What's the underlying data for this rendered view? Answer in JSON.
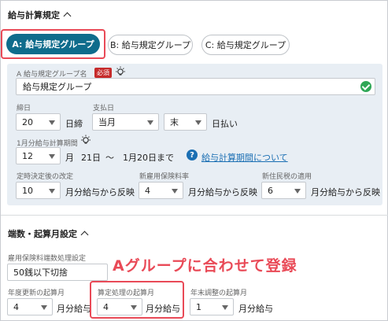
{
  "section1": {
    "title": "給与計算規定"
  },
  "tabs": [
    {
      "label": "A: 給与規定グループ"
    },
    {
      "label": "B: 給与規定グループ"
    },
    {
      "label": "C: 給与規定グループ"
    }
  ],
  "group_name": {
    "label": "A 給与規定グループ名",
    "required_badge": "必須",
    "value": "給与規定グループ"
  },
  "closing_day": {
    "label": "締日",
    "value": "20",
    "suffix": "日締"
  },
  "pay_day": {
    "label": "支払日",
    "month_value": "当月",
    "day_value": "末",
    "suffix": "日払い"
  },
  "period": {
    "label": "1月分給与計算期間",
    "month_value": "12",
    "month_suffix": "月",
    "start": "21日",
    "tilde": "〜",
    "end": "1月20日まで",
    "help_link": "給与計算期間について"
  },
  "regular_revision": {
    "label": "定時決定後の改定",
    "value": "10",
    "suffix": "月分給与から反映"
  },
  "health_insurance": {
    "label": "新雇用保険料率",
    "value": "4",
    "suffix": "月分給与から反映"
  },
  "resident_tax": {
    "label": "新住民税の適用",
    "value": "6",
    "suffix": "月分給与から反映"
  },
  "section2": {
    "title": "端数・起算月設定"
  },
  "rounding": {
    "label": "雇用保険料端数処理設定",
    "value": "50銭以下切捨"
  },
  "annual_update": {
    "label": "年度更新の起算月",
    "value": "4",
    "suffix": "月分給与"
  },
  "calc_start": {
    "label": "算定処理の起算月",
    "value": "4",
    "suffix": "月分給与"
  },
  "year_end": {
    "label": "年末調整の起算月",
    "value": "1",
    "suffix": "月分給与"
  },
  "annotation": {
    "text": "Aグループに合わせて登録"
  },
  "colors": {
    "accent": "#0f6c8c",
    "highlight": "#e94a57",
    "panel": "#e8eef4",
    "link": "#1b6fb3"
  }
}
